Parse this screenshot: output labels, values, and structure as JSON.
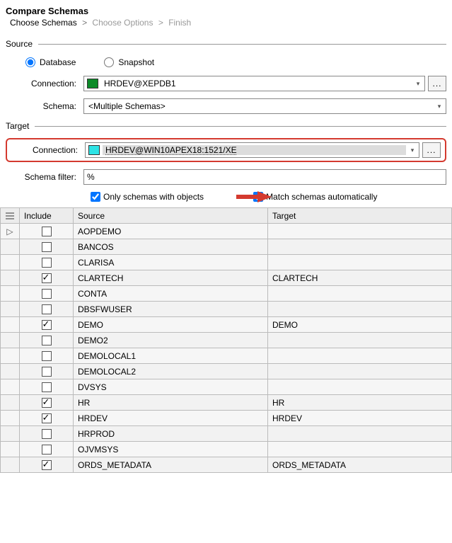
{
  "title": "Compare Schemas",
  "breadcrumb": {
    "step1": "Choose Schemas",
    "step2": "Choose Options",
    "step3": "Finish",
    "sep": ">"
  },
  "source": {
    "heading": "Source",
    "radio_database": "Database",
    "radio_snapshot": "Snapshot",
    "connection_label": "Connection:",
    "connection_value": "HRDEV@XEPDB1",
    "schema_label": "Schema:",
    "schema_value": "<Multiple Schemas>",
    "browse": "..."
  },
  "target": {
    "heading": "Target",
    "connection_label": "Connection:",
    "connection_value": "HRDEV@WIN10APEX18:1521/XE",
    "schema_filter_label": "Schema filter:",
    "schema_filter_value": "%",
    "browse": "...",
    "chk_only_objects": "Only schemas with objects",
    "chk_match_auto": "Match schemas automatically"
  },
  "table": {
    "headers": {
      "include": "Include",
      "source": "Source",
      "target": "Target"
    },
    "rows": [
      {
        "indicator": "▷",
        "include": false,
        "source": "AOPDEMO",
        "target": ""
      },
      {
        "indicator": "",
        "include": false,
        "source": "BANCOS",
        "target": ""
      },
      {
        "indicator": "",
        "include": false,
        "source": "CLARISA",
        "target": ""
      },
      {
        "indicator": "",
        "include": true,
        "source": "CLARTECH",
        "target": "CLARTECH"
      },
      {
        "indicator": "",
        "include": false,
        "source": "CONTA",
        "target": ""
      },
      {
        "indicator": "",
        "include": false,
        "source": "DBSFWUSER",
        "target": ""
      },
      {
        "indicator": "",
        "include": true,
        "source": "DEMO",
        "target": "DEMO"
      },
      {
        "indicator": "",
        "include": false,
        "source": "DEMO2",
        "target": ""
      },
      {
        "indicator": "",
        "include": false,
        "source": "DEMOLOCAL1",
        "target": ""
      },
      {
        "indicator": "",
        "include": false,
        "source": "DEMOLOCAL2",
        "target": ""
      },
      {
        "indicator": "",
        "include": false,
        "source": "DVSYS",
        "target": ""
      },
      {
        "indicator": "",
        "include": true,
        "source": "HR",
        "target": "HR"
      },
      {
        "indicator": "",
        "include": true,
        "source": "HRDEV",
        "target": "HRDEV"
      },
      {
        "indicator": "",
        "include": false,
        "source": "HRPROD",
        "target": ""
      },
      {
        "indicator": "",
        "include": false,
        "source": "OJVMSYS",
        "target": ""
      },
      {
        "indicator": "",
        "include": true,
        "source": "ORDS_METADATA",
        "target": "ORDS_METADATA"
      }
    ]
  }
}
